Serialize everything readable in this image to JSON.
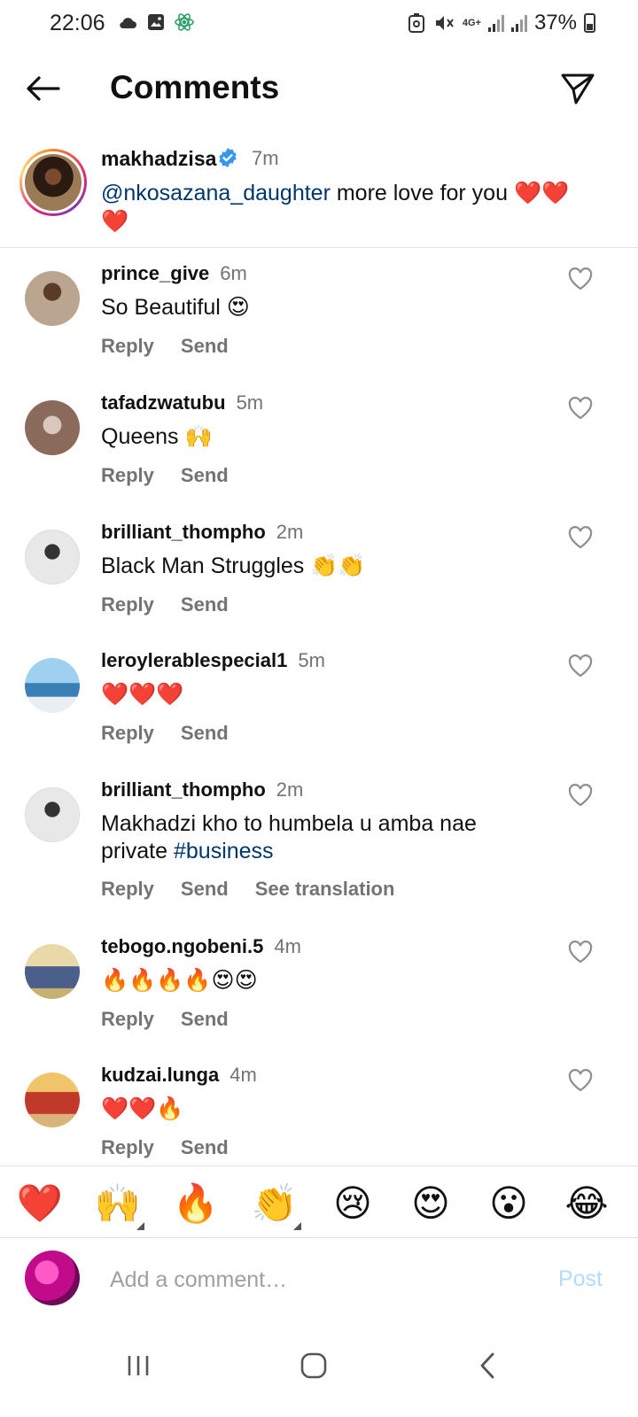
{
  "status_bar": {
    "time": "22:06",
    "network": "4G+",
    "battery": "37%",
    "icons": [
      "cloud-icon",
      "image-icon",
      "atom-icon",
      "data-saver-icon",
      "mute-icon",
      "network-4g-icon",
      "signal-icon",
      "signal-icon",
      "battery-icon"
    ]
  },
  "header": {
    "title": "Comments",
    "back_icon": "arrow-left-icon",
    "share_icon": "paper-plane-icon"
  },
  "caption": {
    "username": "makhadzisa",
    "time": "7m",
    "mention": "@nkosazana_daughter",
    "text": " more love for you ❤️❤️❤️"
  },
  "comments": [
    {
      "username": "prince_give",
      "time": "6m",
      "text": "So Beautiful 😍",
      "actions": [
        "Reply",
        "Send"
      ]
    },
    {
      "username": "tafadzwatubu",
      "time": "5m",
      "text": "Queens 🙌",
      "actions": [
        "Reply",
        "Send"
      ]
    },
    {
      "username": "brilliant_thompho",
      "time": "2m",
      "text": "Black Man Struggles 👏👏",
      "actions": [
        "Reply",
        "Send"
      ]
    },
    {
      "username": "leroylerablespecial1",
      "time": "5m",
      "text": "❤️❤️❤️",
      "actions": [
        "Reply",
        "Send"
      ]
    },
    {
      "username": "brilliant_thompho",
      "time": "2m",
      "text": "Makhadzi kho to humbela u amba nae private ",
      "hashtag": "#business",
      "actions": [
        "Reply",
        "Send",
        "See translation"
      ]
    },
    {
      "username": "tebogo.ngobeni.5",
      "time": "4m",
      "text": "🔥🔥🔥🔥😍😍",
      "actions": [
        "Reply",
        "Send"
      ]
    },
    {
      "username": "kudzai.lunga",
      "time": "4m",
      "text": "❤️❤️🔥",
      "actions": [
        "Reply",
        "Send"
      ]
    }
  ],
  "quick_reactions": [
    "❤️",
    "🙌",
    "🔥",
    "👏",
    "😢",
    "😍",
    "😮",
    "😂"
  ],
  "composer": {
    "placeholder": "Add a comment…",
    "post_label": "Post"
  },
  "nav_bar": {
    "icons": [
      "recents-icon",
      "home-icon",
      "back-icon"
    ]
  },
  "colors": {
    "link": "#00376b",
    "muted": "#737373",
    "post_disabled": "#b3dbff",
    "verified": "#3897f0"
  }
}
